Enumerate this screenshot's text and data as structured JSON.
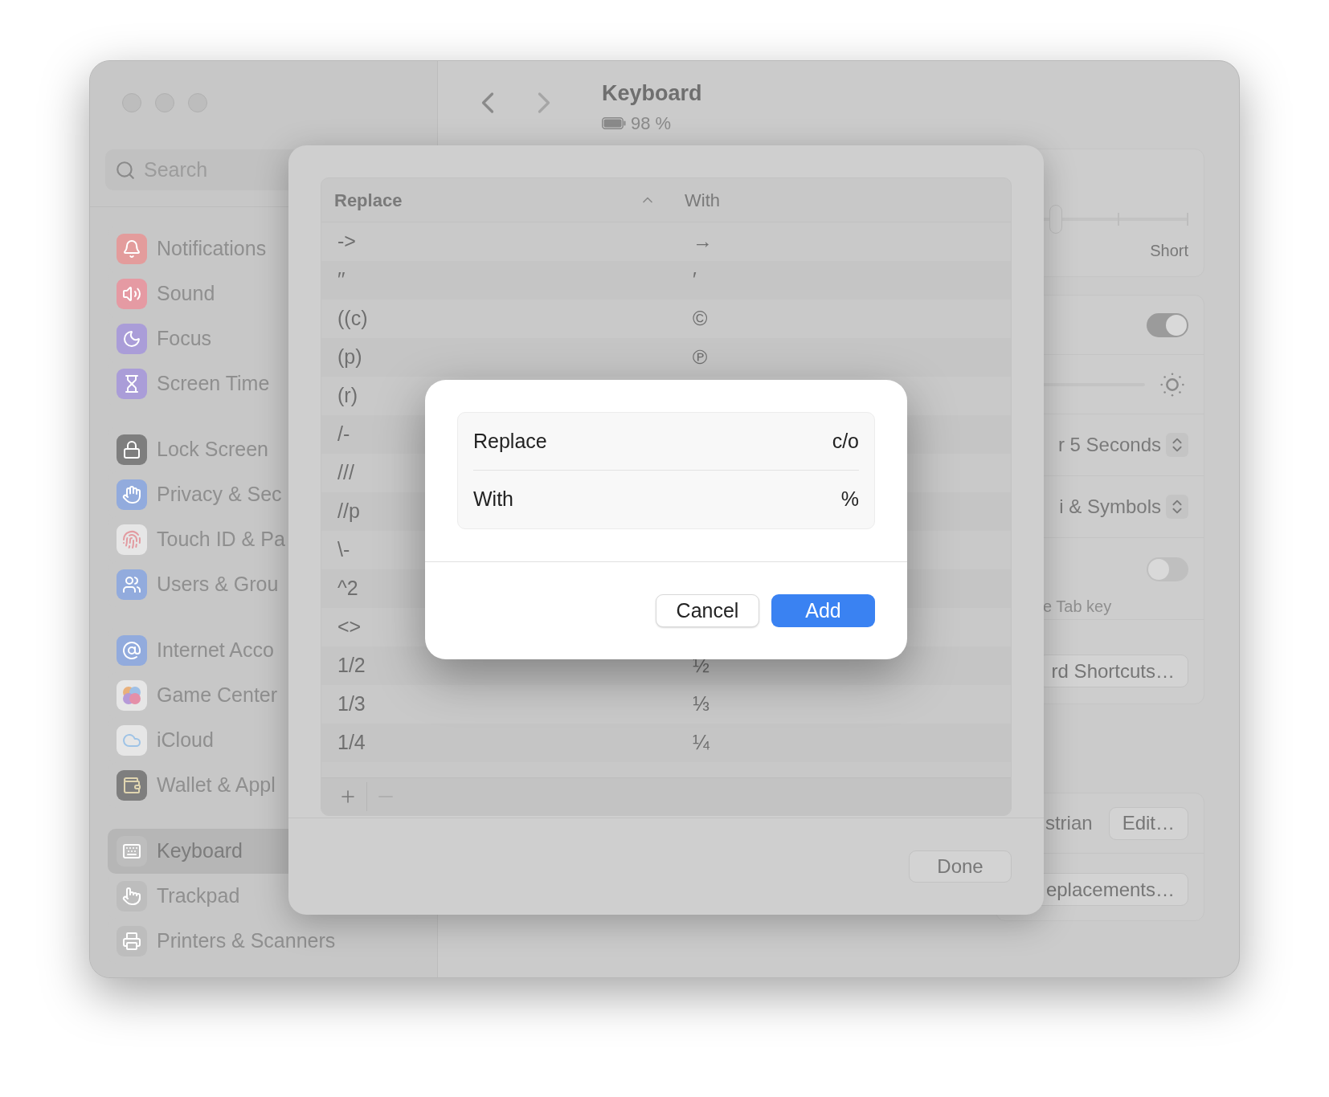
{
  "sidebar": {
    "search": {
      "placeholder": "Search"
    },
    "groups": [
      {
        "items": [
          {
            "label": "Notifications",
            "selected": false
          },
          {
            "label": "Sound",
            "selected": false
          },
          {
            "label": "Focus",
            "selected": false
          },
          {
            "label": "Screen Time",
            "selected": false
          }
        ]
      },
      {
        "items": [
          {
            "label": "Lock Screen",
            "selected": false
          },
          {
            "label": "Privacy & Sec",
            "selected": false
          },
          {
            "label": "Touch ID & Pa",
            "selected": false
          },
          {
            "label": "Users & Grou",
            "selected": false
          }
        ]
      },
      {
        "items": [
          {
            "label": "Internet Acco",
            "selected": false
          },
          {
            "label": "Game Center",
            "selected": false
          },
          {
            "label": "iCloud",
            "selected": false
          },
          {
            "label": "Wallet & Appl",
            "selected": false
          }
        ]
      },
      {
        "items": [
          {
            "label": "Keyboard",
            "selected": true
          },
          {
            "label": "Trackpad",
            "selected": false
          },
          {
            "label": "Printers & Scanners",
            "selected": false
          }
        ]
      }
    ]
  },
  "header": {
    "title": "Keyboard",
    "battery": "98 %"
  },
  "settings_cards": [
    {
      "rows": [
        {
          "kind": "slider",
          "level": 0.25,
          "caption": "Short"
        }
      ]
    },
    {
      "rows": [
        {
          "kind": "toggle",
          "on": true
        },
        {
          "kind": "brightness"
        },
        {
          "kind": "popup",
          "value": "r 5 Seconds"
        },
        {
          "kind": "popup",
          "value": "i & Symbols"
        },
        {
          "kind": "toggle",
          "on": false,
          "caption": "e Tab key"
        },
        {
          "kind": "button",
          "label": "rd Shortcuts…"
        }
      ]
    },
    {
      "rows": [
        {
          "kind": "text_button",
          "text": "strian",
          "label": "Edit…"
        },
        {
          "kind": "button",
          "label": "eplacements…"
        }
      ]
    }
  ],
  "sheet": {
    "table": {
      "columns": [
        "Replace",
        "With"
      ],
      "rows": [
        {
          "replace": "->",
          "with": "→"
        },
        {
          "replace": "′′",
          "with": "′"
        },
        {
          "replace": "((c)",
          "with": "©"
        },
        {
          "replace": "(p)",
          "with": "℗"
        },
        {
          "replace": "(r)"
        },
        {
          "replace": "/-"
        },
        {
          "replace": "///"
        },
        {
          "replace": "//p"
        },
        {
          "replace": "\\-"
        },
        {
          "replace": "^2"
        },
        {
          "replace": "<>"
        },
        {
          "replace": "1/2",
          "with": "½"
        },
        {
          "replace": "1/3",
          "with": "⅓"
        },
        {
          "replace": "1/4",
          "with": "¼"
        }
      ],
      "actions": [
        {
          "kind": "add",
          "disabled": false
        },
        {
          "kind": "remove",
          "disabled": true
        }
      ]
    },
    "done_button": "Done"
  },
  "dialog": {
    "fields": [
      {
        "label": "Replace",
        "value": "c/o"
      },
      {
        "label": "With",
        "value": "%"
      }
    ],
    "buttons": [
      {
        "label": "Cancel",
        "kind": "secondary"
      },
      {
        "label": "Add",
        "kind": "primary"
      }
    ]
  }
}
